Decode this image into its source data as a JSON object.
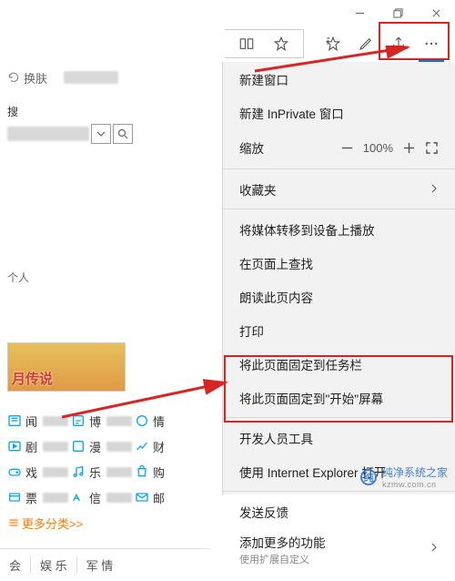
{
  "window": {
    "min": "—",
    "restore": "❐",
    "close": "✕"
  },
  "toolbar": {
    "reading_view": "reading-view",
    "favorite": "favorite",
    "favorites_list": "favorites-list",
    "notes": "web-notes",
    "share": "share",
    "more": "more"
  },
  "tabrow": {
    "change_skin": "换肤"
  },
  "search": {
    "label": "搜"
  },
  "left": {
    "caption": "个人",
    "promo": "月传说"
  },
  "categories": {
    "rows": [
      [
        {
          "label": "闻"
        },
        {
          "label": "博"
        },
        {
          "label": "情"
        }
      ],
      [
        {
          "label": "剧"
        },
        {
          "label": "漫"
        },
        {
          "label": "财"
        }
      ],
      [
        {
          "label": "戏"
        },
        {
          "label": "乐"
        },
        {
          "label": "购"
        }
      ],
      [
        {
          "label": "票"
        },
        {
          "label": "信"
        },
        {
          "label": "邮"
        }
      ]
    ],
    "more": "更多分类>>"
  },
  "bottom_tabs": [
    "会",
    "娱 乐",
    "军 情"
  ],
  "menu": {
    "new_window": "新建窗口",
    "new_inprivate": "新建 InPrivate 窗口",
    "zoom_label": "缩放",
    "zoom_value": "100%",
    "favorites": "收藏夹",
    "cast": "将媒体转移到设备上播放",
    "find": "在页面上查找",
    "read_aloud": "朗读此页内容",
    "print": "打印",
    "pin_taskbar": "将此页面固定到任务栏",
    "pin_start": "将此页面固定到\"开始\"屏幕",
    "dev_tools": "开发人员工具",
    "open_ie": "使用 Internet Explorer 打开",
    "feedback": "发送反馈",
    "extensions": "添加更多的功能",
    "extensions_sub": "使用扩展自定义"
  },
  "watermark": {
    "title": "纯净系统之家",
    "url": "kzmw.com.cn"
  }
}
